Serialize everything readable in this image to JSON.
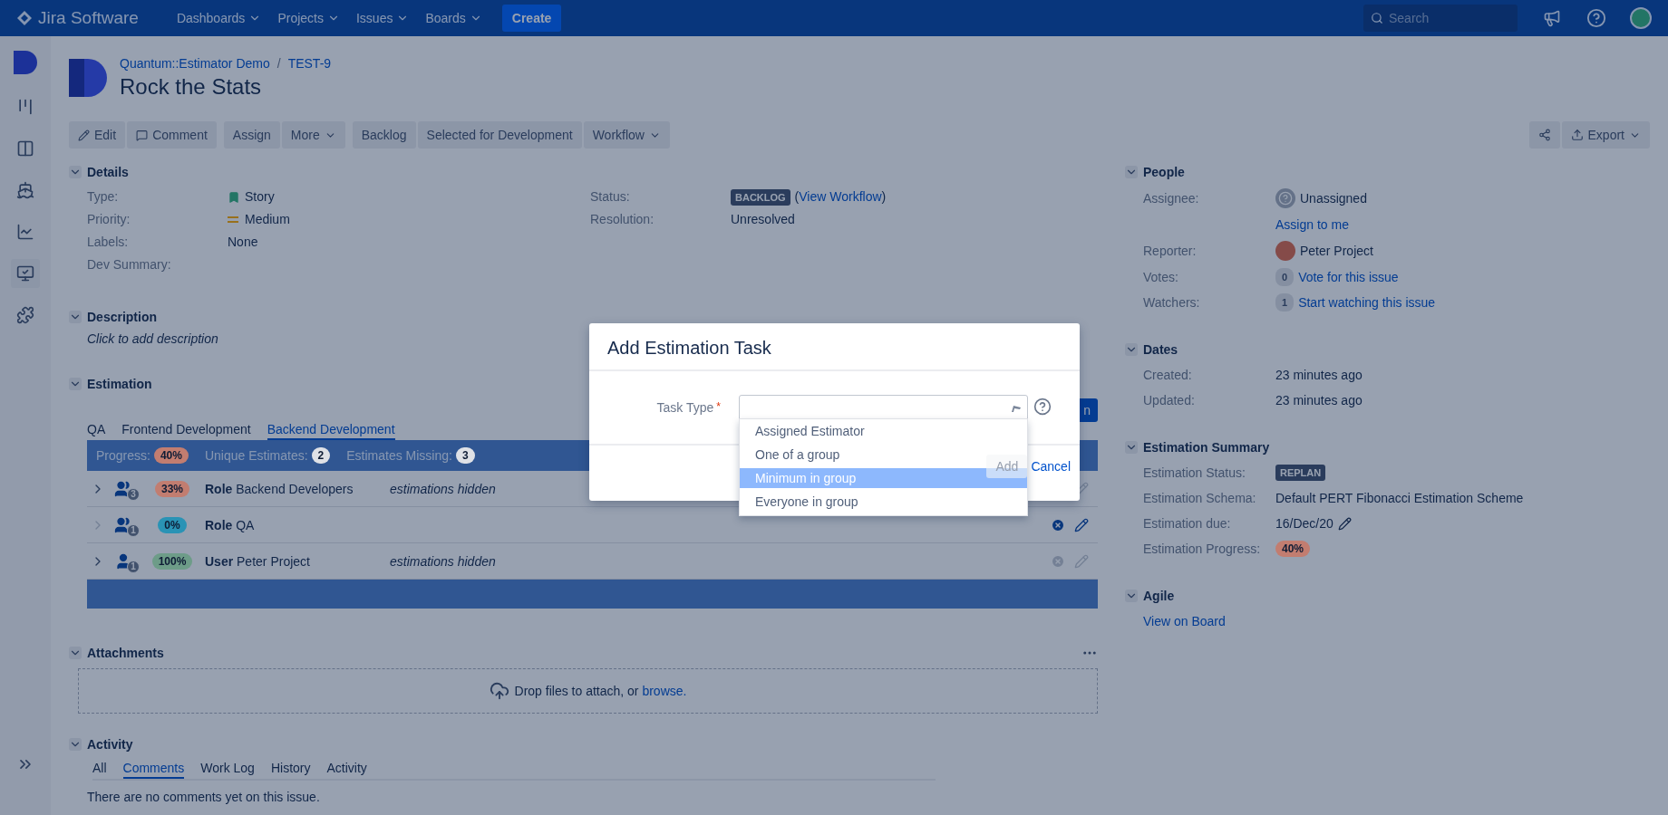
{
  "nav": {
    "logo": "Jira Software",
    "menus": [
      {
        "label": "Dashboards"
      },
      {
        "label": "Projects"
      },
      {
        "label": "Issues"
      },
      {
        "label": "Boards"
      }
    ],
    "create": "Create",
    "search_placeholder": "Search"
  },
  "issue": {
    "project": "Quantum::Estimator Demo",
    "separator": "/",
    "key": "TEST-9",
    "title": "Rock the Stats"
  },
  "toolbar": {
    "groups": [
      [
        {
          "label": "Edit",
          "kind": "edit"
        },
        {
          "label": "Comment",
          "kind": "comment"
        }
      ],
      [
        {
          "label": "Assign",
          "kind": "plain"
        },
        {
          "label": "More",
          "kind": "menu"
        }
      ],
      [
        {
          "label": "Backlog",
          "kind": "plain"
        },
        {
          "label": "Selected for Development",
          "kind": "plain"
        },
        {
          "label": "Workflow",
          "kind": "menu"
        }
      ]
    ],
    "right": [
      {
        "kind": "share"
      },
      {
        "label": "Export",
        "kind": "export"
      }
    ]
  },
  "details": {
    "title": "Details",
    "left": [
      {
        "label": "Type:",
        "value": "Story",
        "kind": "story"
      },
      {
        "label": "Priority:",
        "value": "Medium",
        "kind": "priority"
      },
      {
        "label": "Labels:",
        "value": "None",
        "kind": "text"
      },
      {
        "label": "Dev Summary:",
        "kind": "text"
      }
    ],
    "right": [
      {
        "label": "Status:",
        "kind": "status",
        "badge": "BACKLOG",
        "link_before": "(",
        "link": "View Workflow",
        "link_after": ")"
      },
      {
        "label": "Resolution:",
        "value": "Unresolved",
        "kind": "text"
      }
    ]
  },
  "description": {
    "title": "Description",
    "placeholder": "Click to add description"
  },
  "estimation": {
    "title": "Estimation",
    "add_button": "n",
    "tabs": [
      {
        "label": "QA",
        "selected": false
      },
      {
        "label": "Frontend Development",
        "selected": false
      },
      {
        "label": "Backend Development",
        "selected": true
      }
    ],
    "summary": [
      {
        "label": "Progress:",
        "badge": "40%",
        "kind": "progress",
        "color": "#c27d70"
      },
      {
        "label": "Unique Estimates:",
        "badge": "2",
        "kind": "count"
      },
      {
        "label": "Estimates Missing:",
        "badge": "3",
        "kind": "count"
      }
    ],
    "rows": [
      {
        "kind": "group",
        "count": "3",
        "percent": "33%",
        "color": "#c27d70",
        "type": "Role",
        "name": "Backend Developers",
        "note": "estimations hidden",
        "expandable": true,
        "actions_enabled": false
      },
      {
        "kind": "group",
        "count": "1",
        "percent": "0%",
        "color": "#2a93b5",
        "type": "Role",
        "name": "QA",
        "expandable": false,
        "actions_enabled": true
      },
      {
        "kind": "user",
        "count": "1",
        "percent": "100%",
        "color": "#6d9c88",
        "type": "User",
        "name": "Peter Project",
        "note": "estimations hidden",
        "expandable": true,
        "actions_enabled": false
      }
    ]
  },
  "attachments": {
    "title": "Attachments",
    "drop_text": "Drop files to attach, or ",
    "link": "browse."
  },
  "activity": {
    "title": "Activity",
    "tabs": [
      {
        "label": "All",
        "selected": false
      },
      {
        "label": "Comments",
        "selected": true
      },
      {
        "label": "Work Log",
        "selected": false
      },
      {
        "label": "History",
        "selected": false
      },
      {
        "label": "Activity",
        "selected": false
      }
    ],
    "empty": "There are no comments yet on this issue."
  },
  "people": {
    "title": "People",
    "assignee": {
      "label": "Assignee:",
      "value": "Unassigned",
      "action": "Assign to me"
    },
    "reporter": {
      "label": "Reporter:",
      "value": "Peter Project"
    },
    "votes": {
      "label": "Votes:",
      "count": "0",
      "action": "Vote for this issue"
    },
    "watchers": {
      "label": "Watchers:",
      "count": "1",
      "action": "Start watching this issue"
    }
  },
  "dates": {
    "title": "Dates",
    "rows": [
      {
        "label": "Created:",
        "value": "23 minutes ago"
      },
      {
        "label": "Updated:",
        "value": "23 minutes ago"
      }
    ]
  },
  "estimation_summary": {
    "title": "Estimation Summary",
    "rows": [
      {
        "label": "Estimation Status:",
        "kind": "status",
        "value": "REPLAN"
      },
      {
        "label": "Estimation Schema:",
        "kind": "text",
        "value": "Default PERT Fibonacci Estimation Scheme"
      },
      {
        "label": "Estimation due:",
        "kind": "editable",
        "value": "16/Dec/20"
      },
      {
        "label": "Estimation Progress:",
        "kind": "progress",
        "value": "40%",
        "color": "#c27d70"
      }
    ]
  },
  "agile": {
    "title": "Agile",
    "link": "View on Board"
  },
  "dialog": {
    "title": "Add Estimation Task",
    "field": {
      "label": "Task Type",
      "required_mark": "*"
    },
    "options": [
      {
        "label": "Assigned Estimator",
        "selected": false
      },
      {
        "label": "One of a group",
        "selected": false
      },
      {
        "label": "Minimum in group",
        "selected": true
      },
      {
        "label": "Everyone in group",
        "selected": false
      }
    ],
    "submit": {
      "label": "Add",
      "disabled": true
    },
    "cancel": "Cancel"
  }
}
